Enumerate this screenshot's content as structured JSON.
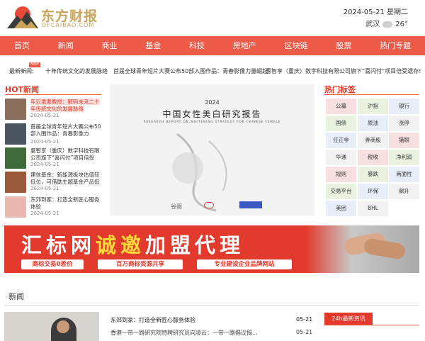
{
  "header": {
    "logo_title": "东方财报",
    "logo_sub": "DFCAIBAO.COM",
    "date": "2024-05-21 星期二",
    "city": "武汉",
    "temperature": "26°",
    "weather_icon": "cloud-icon"
  },
  "nav": [
    "首页",
    "新闻",
    "商业",
    "基金",
    "科技",
    "房地产",
    "区块链",
    "股票",
    "热门专题"
  ],
  "ticker": {
    "label": "最新新闻:",
    "badge": "NEW",
    "items": [
      "十年传统文化的发展脉络",
      "首届全球青年短片大赛公布50部入围作品：青春影像力量崛起",
      "惠智享（重庆）数字科技有限公司旗下“喜闪付”项目倍受遗存!"
    ]
  },
  "hot": {
    "title": "HOT新闻",
    "items": [
      {
        "text": "年近耄耋教授：解码未来二十年传统文化的发展脉络",
        "date": "2024-05-21"
      },
      {
        "text": "首届全球青年短片大赛公布50部入围作品：青春影像力",
        "date": "2024-05-21"
      },
      {
        "text": "惠智享（重庆）数字科技有限公司旗下“喜闪付”项目倍受",
        "date": "2024-05-21"
      },
      {
        "text": "建信基金：新能源板块估值较低位，可借助主题基金产品低",
        "date": "2024-05-21"
      },
      {
        "text": "东郊到家：打造全新匠心服务体验",
        "date": "2024-05-21"
      }
    ]
  },
  "report": {
    "year": "2024",
    "title": "中国女性美白研究报告",
    "subtitle": "RESEARCH REPORT ON WHITENING STRATEGY FOR CHINESE FEMALE",
    "brand": "谷雨"
  },
  "tags": {
    "title": "热门标签",
    "items": [
      "公募",
      "沪指",
      "银行",
      "国债",
      "原油",
      "涨停",
      "任正非",
      "券商股",
      "猫眼",
      "华通",
      "税收",
      "净利润",
      "规则",
      "暴跌",
      "两面性",
      "交易平台",
      "环保",
      "飙升",
      "美团",
      "BHL"
    ],
    "colors": [
      "#f7dfe0",
      "#e8f2de",
      "#e8eef7",
      "#f2f2f2"
    ]
  },
  "banner": {
    "title_a": "汇标网",
    "title_hl": "诚邀",
    "title_b": "加盟代理",
    "pills": [
      "商标交易0差价",
      "百万商标资源共享",
      "专业建设企业品牌网站"
    ]
  },
  "news": {
    "title": "新闻",
    "items": [
      {
        "text": "东郊到家：打造全新匠心服务体验",
        "date": "05-21"
      },
      {
        "text": "香港一带一路研究院特聘研究员向凌云：一带一路倡议揭...",
        "date": "05-21"
      }
    ],
    "h24_label": "24h最新资讯"
  }
}
